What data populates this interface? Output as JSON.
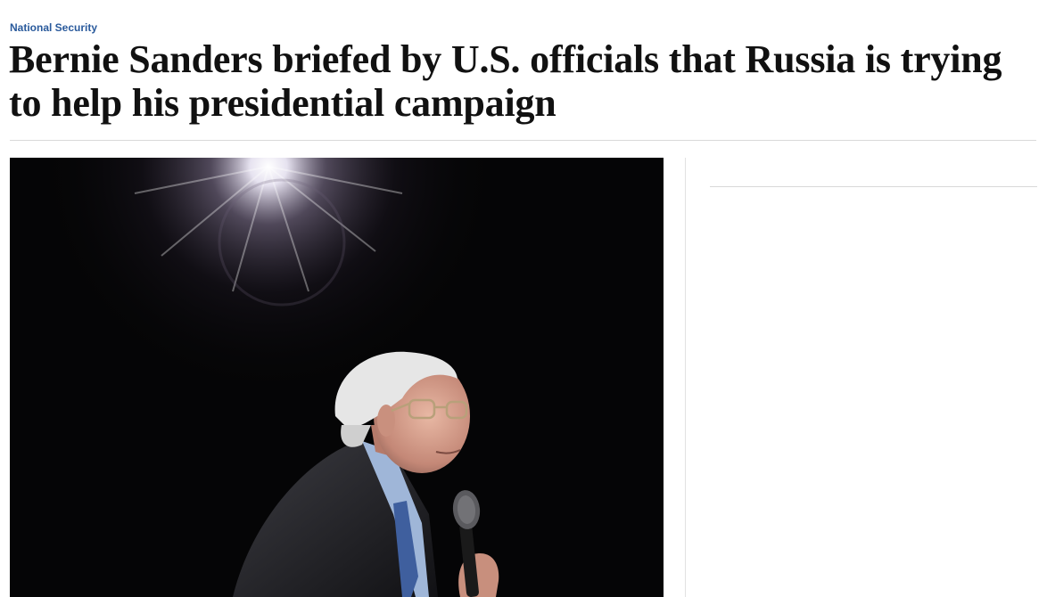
{
  "article": {
    "section_label": "National Security",
    "headline": "Bernie Sanders briefed by U.S. officials that Russia is trying to help his presidential campaign"
  },
  "media": {
    "lead_photo": {
      "subject": "Bernie Sanders speaking into a microphone on a dark stage under a spotlight"
    }
  },
  "colors": {
    "section_link": "#2a5a9c",
    "headline_text": "#111111",
    "rule": "#d9d9d9",
    "photo_background": "#050506"
  }
}
